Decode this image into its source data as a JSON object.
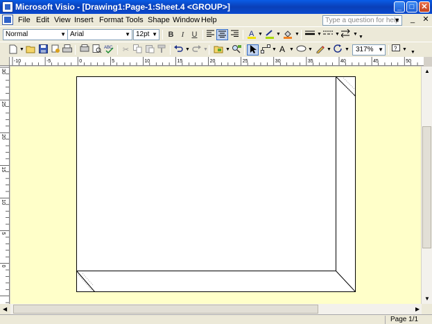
{
  "window": {
    "title": "Microsoft Visio - [Drawing1:Page-1:Sheet.4  <GROUP>]",
    "minimize": "_",
    "maximize": "□",
    "close": "✕"
  },
  "menu": {
    "items": [
      "File",
      "Edit",
      "View",
      "Insert",
      "Format",
      "Tools",
      "Shape",
      "Window",
      "Help"
    ],
    "help_placeholder": "Type a question for help"
  },
  "format_toolbar": {
    "style": "Normal",
    "font": "Arial",
    "size": "12pt",
    "bold": "B",
    "italic": "I",
    "underline": "U"
  },
  "standard_toolbar": {
    "zoom": "317%"
  },
  "ruler": {
    "h_labels": [
      "-10",
      "-5",
      "0",
      "5",
      "10",
      "15",
      "20",
      "25",
      "30",
      "35",
      "40",
      "45",
      "50"
    ],
    "v_labels": [
      "30",
      "25",
      "20",
      "15",
      "10",
      "5",
      "0"
    ]
  },
  "status": {
    "page": "Page 1/1"
  },
  "colors": {
    "canvas": "#ffffc9",
    "titlebar": "#0a49cf"
  }
}
